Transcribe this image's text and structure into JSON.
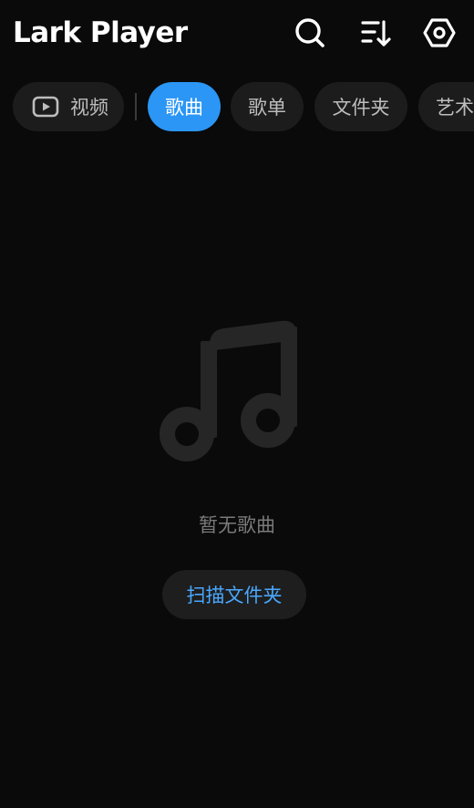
{
  "header": {
    "app_title": "Lark Player",
    "icons": {
      "search": "search-icon",
      "sort": "sort-icon",
      "settings": "settings-icon"
    }
  },
  "tabs": [
    {
      "label": "视频",
      "icon": "video-icon",
      "active": false
    },
    {
      "label": "歌曲",
      "active": true
    },
    {
      "label": "歌单",
      "active": false
    },
    {
      "label": "文件夹",
      "active": false
    },
    {
      "label": "艺术",
      "active": false
    }
  ],
  "empty_state": {
    "icon": "music-note-icon",
    "message": "暂无歌曲",
    "scan_button_label": "扫描文件夹"
  },
  "colors": {
    "background": "#0a0a0a",
    "accent": "#2b96f5",
    "link": "#4aa8ff",
    "chip": "#1c1c1c",
    "icon_muted": "#262626"
  }
}
